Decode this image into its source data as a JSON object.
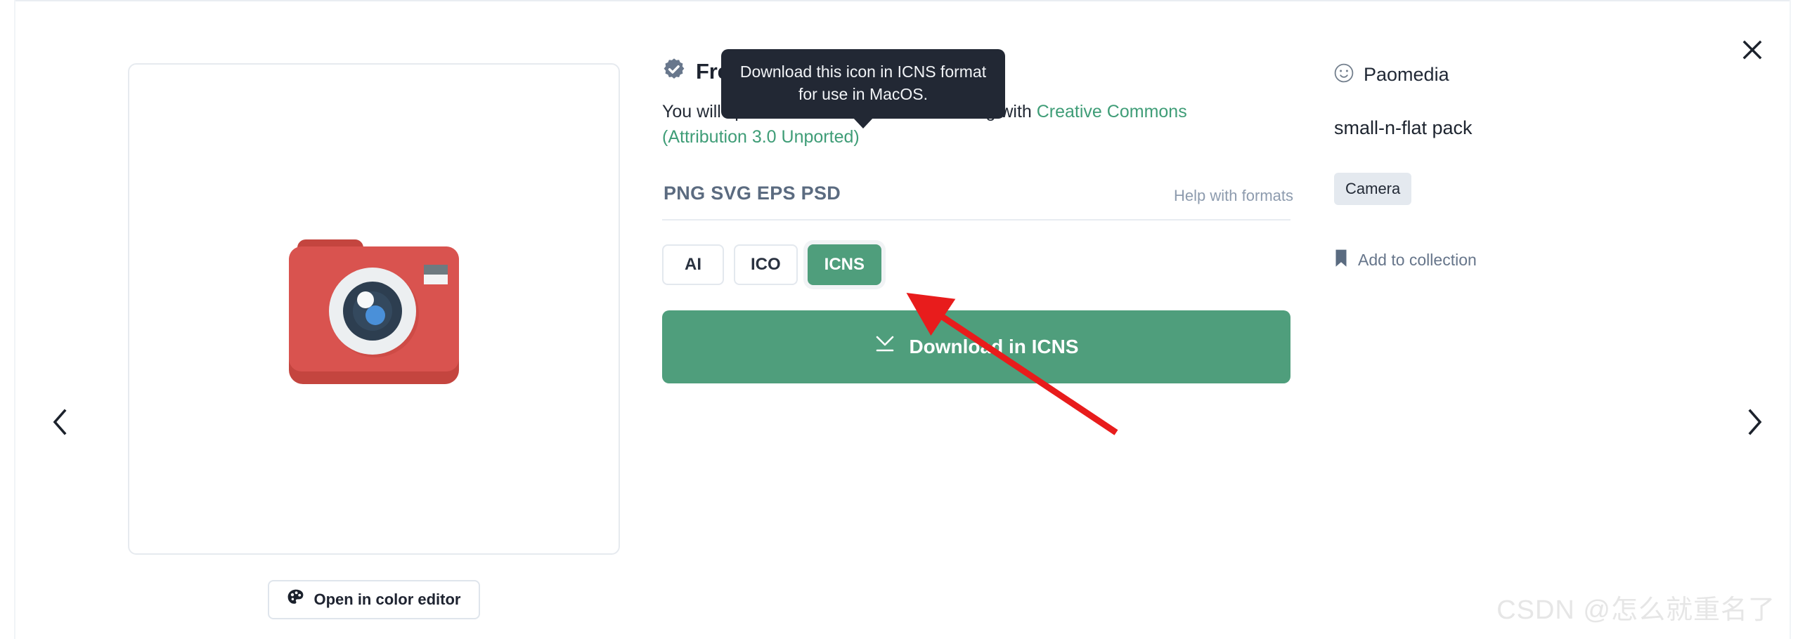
{
  "window": {
    "close_icon": "close-icon",
    "prev_icon": "chevron-left-icon",
    "next_icon": "chevron-right-icon"
  },
  "preview": {
    "icon_name": "camera-icon",
    "icon_alt": "Camera",
    "color_editor_button": "Open in color editor",
    "color_editor_icon": "palette-icon",
    "colors": {
      "body": "#d9534f",
      "body_light": "#e05c4e",
      "body_dark": "#c4453f",
      "lens_ring": "#eceff1",
      "lens_outer": "#2d3e50",
      "lens_inner": "#34495e",
      "lens_center": "#4a90d9",
      "flash_top": "#6e7a80",
      "flash_bottom": "#f2f4f5"
    }
  },
  "detail": {
    "badge_icon": "verified-badge-icon",
    "badge_color": "#68778c",
    "title": "Free icon",
    "credits_prefix": "You will spend 0 credits when downloading with ",
    "license_link": "Creative Commons (Attribution 3.0 Unported)",
    "license_link_color": "#3f9d77",
    "format_types_label": "PNG  SVG  EPS  PSD",
    "help_link": "Help with formats",
    "format_buttons": [
      {
        "label": "AI",
        "active": false
      },
      {
        "label": "ICO",
        "active": false
      },
      {
        "label": "ICNS",
        "active": true
      }
    ],
    "tooltip": "Download this icon in ICNS format for use in MacOS.",
    "download_icon": "download-icon",
    "download_button": "Download in ICNS",
    "accent_color": "#4f9e7c"
  },
  "meta": {
    "author_icon": "smiley-face-icon",
    "author": "Paomedia",
    "pack": "small-n-flat pack",
    "tags": [
      "Camera"
    ],
    "collection_icon": "bookmark-icon",
    "collection_label": "Add to collection",
    "collection_icon_color": "#5a6b80"
  },
  "annotation": {
    "arrow_color": "#e81c1c",
    "target": "icns-format-button"
  },
  "watermark": "CSDN @怎么就重名了"
}
